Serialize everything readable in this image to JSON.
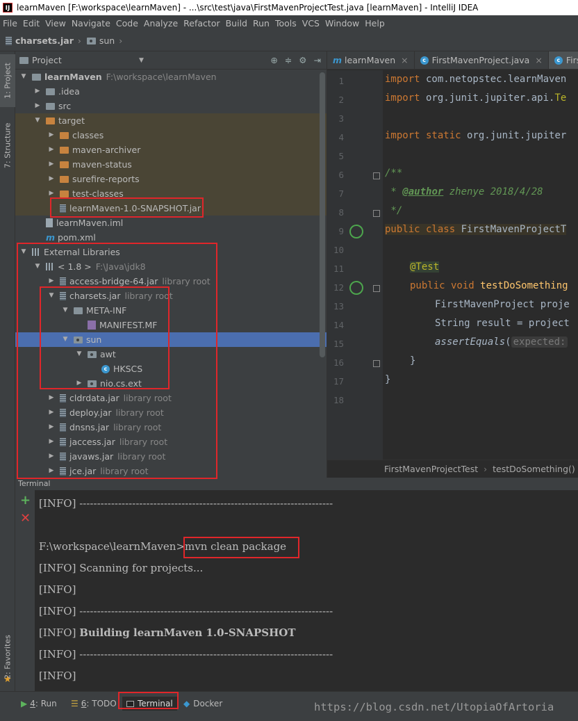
{
  "window": {
    "title": "learnMaven [F:\\workspace\\learnMaven] - ...\\src\\test\\java\\FirstMavenProjectTest.java [learnMaven] - IntelliJ IDEA",
    "app_icon": "IJ"
  },
  "menu": [
    "File",
    "Edit",
    "View",
    "Navigate",
    "Code",
    "Analyze",
    "Refactor",
    "Build",
    "Run",
    "Tools",
    "VCS",
    "Window",
    "Help"
  ],
  "breadcrumb": [
    "charsets.jar",
    "sun"
  ],
  "side_tabs": {
    "project": "1: Project",
    "structure": "7: Structure",
    "favorites": "2: Favorites"
  },
  "project": {
    "header": "Project",
    "tree": [
      {
        "label": "learnMaven",
        "extra": "F:\\workspace\\learnMaven",
        "arrow": "▼",
        "indent": 0,
        "icon": "folder",
        "bold": true
      },
      {
        "label": ".idea",
        "arrow": "▶",
        "indent": 1,
        "icon": "folder"
      },
      {
        "label": "src",
        "arrow": "▶",
        "indent": 1,
        "icon": "folder"
      },
      {
        "label": "target",
        "arrow": "▼",
        "indent": 1,
        "icon": "folder-orange",
        "hl": true
      },
      {
        "label": "classes",
        "arrow": "▶",
        "indent": 2,
        "icon": "folder-orange",
        "hl": true
      },
      {
        "label": "maven-archiver",
        "arrow": "▶",
        "indent": 2,
        "icon": "folder-orange",
        "hl": true
      },
      {
        "label": "maven-status",
        "arrow": "▶",
        "indent": 2,
        "icon": "folder-orange",
        "hl": true
      },
      {
        "label": "surefire-reports",
        "arrow": "▶",
        "indent": 2,
        "icon": "folder-orange",
        "hl": true
      },
      {
        "label": "test-classes",
        "arrow": "▶",
        "indent": 2,
        "icon": "folder-orange",
        "hl": true
      },
      {
        "label": "learnMaven-1.0-SNAPSHOT.jar",
        "arrow": "",
        "indent": 2,
        "icon": "jar",
        "hl": true
      },
      {
        "label": "learnMaven.iml",
        "arrow": "",
        "indent": 1,
        "icon": "file"
      },
      {
        "label": "pom.xml",
        "arrow": "",
        "indent": 1,
        "icon": "maven"
      },
      {
        "label": "External Libraries",
        "arrow": "▼",
        "indent": 0,
        "icon": "lib"
      },
      {
        "label": "< 1.8 >",
        "extra": "F:\\Java\\jdk8",
        "arrow": "▼",
        "indent": 1,
        "icon": "lib"
      },
      {
        "label": "access-bridge-64.jar",
        "extra": "library root",
        "arrow": "▶",
        "indent": 2,
        "icon": "jar"
      },
      {
        "label": "charsets.jar",
        "extra": "library root",
        "arrow": "▼",
        "indent": 2,
        "icon": "jar"
      },
      {
        "label": "META-INF",
        "arrow": "▼",
        "indent": 3,
        "icon": "folder"
      },
      {
        "label": "MANIFEST.MF",
        "arrow": "",
        "indent": 4,
        "icon": "mf"
      },
      {
        "label": "sun",
        "arrow": "▼",
        "indent": 3,
        "icon": "pkg",
        "selected": true
      },
      {
        "label": "awt",
        "arrow": "▼",
        "indent": 4,
        "icon": "pkg"
      },
      {
        "label": "HKSCS",
        "arrow": "",
        "indent": 5,
        "icon": "class"
      },
      {
        "label": "nio.cs.ext",
        "arrow": "▶",
        "indent": 4,
        "icon": "pkg"
      },
      {
        "label": "cldrdata.jar",
        "extra": "library root",
        "arrow": "▶",
        "indent": 2,
        "icon": "jar"
      },
      {
        "label": "deploy.jar",
        "extra": "library root",
        "arrow": "▶",
        "indent": 2,
        "icon": "jar"
      },
      {
        "label": "dnsns.jar",
        "extra": "library root",
        "arrow": "▶",
        "indent": 2,
        "icon": "jar"
      },
      {
        "label": "jaccess.jar",
        "extra": "library root",
        "arrow": "▶",
        "indent": 2,
        "icon": "jar"
      },
      {
        "label": "javaws.jar",
        "extra": "library root",
        "arrow": "▶",
        "indent": 2,
        "icon": "jar"
      },
      {
        "label": "jce.jar",
        "extra": "library root",
        "arrow": "▶",
        "indent": 2,
        "icon": "jar"
      }
    ]
  },
  "editor": {
    "tabs": [
      {
        "label": "learnMaven",
        "icon": "m"
      },
      {
        "label": "FirstMavenProject.java",
        "icon": "c"
      },
      {
        "label": "FirstM",
        "icon": "c"
      }
    ],
    "line_numbers": [
      "1",
      "2",
      "3",
      "4",
      "5",
      "6",
      "7",
      "8",
      "9",
      "10",
      "11",
      "12",
      "13",
      "14",
      "15",
      "16",
      "17",
      "18"
    ],
    "code": {
      "l1a": "import",
      "l1b": " com.netopstec.learnMaven",
      "l2a": "import",
      "l2b": " org.junit.jupiter.api.",
      "l2c": "Te",
      "l4a": "import static",
      "l4b": " org.junit.jupiter",
      "l6": "/**",
      "l7a": " * ",
      "l7b": "@author",
      "l7c": " zhenye 2018/4/28",
      "l8": " */",
      "l9a": "public class",
      "l9b": " FirstMavenProjectT",
      "l11": "@Test",
      "l12a": "public void",
      "l12b": " testDoSomething",
      "l13": "FirstMavenProject proje",
      "l14": "String result = project",
      "l15a": "assertEquals",
      "l15b": "(",
      "l15c": "expected:",
      "l16": "}",
      "l17": "}"
    },
    "breadcrumb": [
      "FirstMavenProjectTest",
      "testDoSomething()"
    ]
  },
  "terminal": {
    "title": "Terminal",
    "lines": {
      "t1": "[INFO] ------------------------------------------------------------------------",
      "t2": "F:\\workspace\\learnMaven>",
      "t2cmd": "mvn clean package",
      "t3": "[INFO] Scanning for projects...",
      "t4": "[INFO]",
      "t5": "[INFO] ------------------------------------------------------------------------",
      "t6a": "[INFO] ",
      "t6b": "Building learnMaven 1.0-SNAPSHOT",
      "t7": "[INFO] ------------------------------------------------------------------------",
      "t8": "[INFO]"
    }
  },
  "bottom_tools": {
    "run_num": "4",
    "run": ": Run",
    "todo_num": "6",
    "todo": ": TODO",
    "terminal": "Terminal",
    "docker": "Docker"
  },
  "watermark": "https://blog.csdn.net/UtopiaOfArtoria",
  "colors": {
    "highlight_box": "#e0262a",
    "selection": "#4b6eaf",
    "keyword": "#cc7832"
  }
}
